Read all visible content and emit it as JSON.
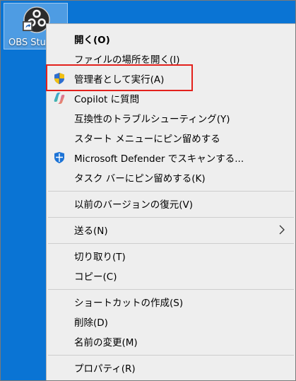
{
  "desktop": {
    "icon_label": "OBS Stu",
    "icon": "obs-studio-icon"
  },
  "menu": {
    "items": [
      {
        "label": "開く(O)",
        "bold": true
      },
      {
        "label": "ファイルの場所を開く(I)"
      },
      {
        "label": "管理者として実行(A)",
        "icon": "uac-shield-icon"
      },
      {
        "label": "Copilot に質問",
        "icon": "copilot-icon"
      },
      {
        "label": "互換性のトラブルシューティング(Y)"
      },
      {
        "label": "スタート メニューにピン留めする"
      },
      {
        "label": "Microsoft Defender でスキャンする...",
        "icon": "defender-shield-icon"
      },
      {
        "label": "タスク バーにピン留めする(K)"
      },
      {
        "label": "以前のバージョンの復元(V)"
      },
      {
        "label": "送る(N)",
        "submenu": true
      },
      {
        "label": "切り取り(T)"
      },
      {
        "label": "コピー(C)"
      },
      {
        "label": "ショートカットの作成(S)"
      },
      {
        "label": "削除(D)"
      },
      {
        "label": "名前の変更(M)"
      },
      {
        "label": "プロパティ(R)"
      }
    ]
  },
  "colors": {
    "desktop_bg": "#0a74d4",
    "menu_bg": "#eeeeee",
    "highlight_border": "#e3211c"
  }
}
